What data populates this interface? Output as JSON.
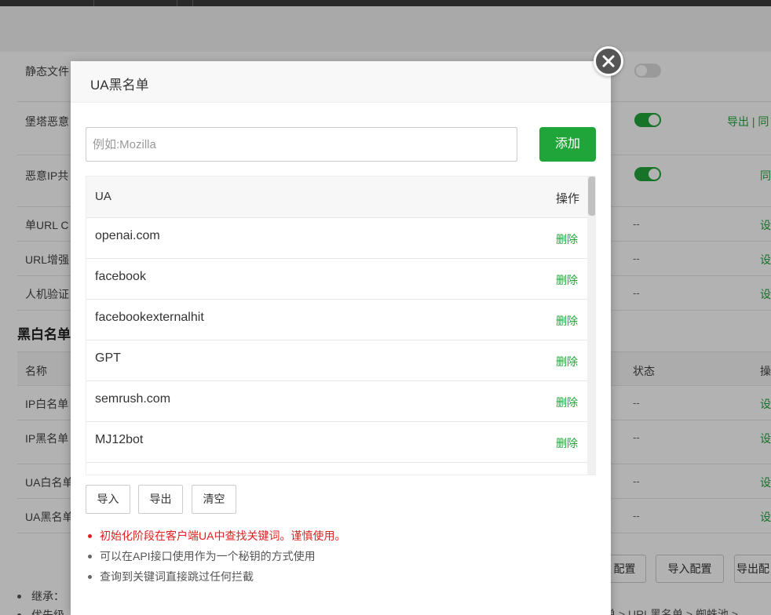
{
  "background": {
    "rows": [
      {
        "name": "静态文件",
        "switch": "off"
      },
      {
        "name": "堡塔恶意",
        "switch": "on",
        "right": "导出 | 同"
      },
      {
        "name": "恶意IP共",
        "switch": "on",
        "right": "同"
      },
      {
        "name": "单URL C",
        "mid": "--",
        "right": "设"
      },
      {
        "name": "URL增强",
        "mid": "--",
        "right": "设"
      },
      {
        "name": "人机验证",
        "mid": "--",
        "right": "设"
      }
    ],
    "section_title": "黑白名单",
    "header": {
      "name": "名称",
      "status": "状态",
      "op": "操"
    },
    "list_rows": [
      {
        "name": "IP白名单",
        "mid": "--",
        "right": "设"
      },
      {
        "name": "IP黑名单",
        "mid": "--",
        "right": "设"
      },
      {
        "name": "UA白名单",
        "mid": "--",
        "right": "设"
      },
      {
        "name": "UA黑名单",
        "mid": "--",
        "right": "设"
      }
    ],
    "buttons": {
      "config": "配置",
      "import_config": "导入配置",
      "export_config": "导出配"
    },
    "bullets": [
      "继承：",
      "优先级"
    ],
    "breadcrumb": "单 > URL黑名单 > 蜘蛛池 >"
  },
  "modal": {
    "title": "UA黑名单",
    "input_placeholder": "例如:Mozilla",
    "add_label": "添加",
    "table": {
      "col_ua": "UA",
      "col_op": "操作",
      "delete_label": "删除",
      "rows": [
        "openai.com",
        "facebook",
        "facebookexternalhit",
        "GPT",
        "semrush.com",
        "MJ12bot"
      ]
    },
    "footer_buttons": {
      "import": "导入",
      "export": "导出",
      "clear": "清空"
    },
    "notes": [
      "初始化阶段在客户端UA中查找关键词。谨慎使用。",
      "可以在API接口使用作为一个秘钥的方式使用",
      "查询到关键词直接跳过任何拦截"
    ]
  },
  "colors": {
    "accent": "#20a53a",
    "warning": "#e02020"
  }
}
